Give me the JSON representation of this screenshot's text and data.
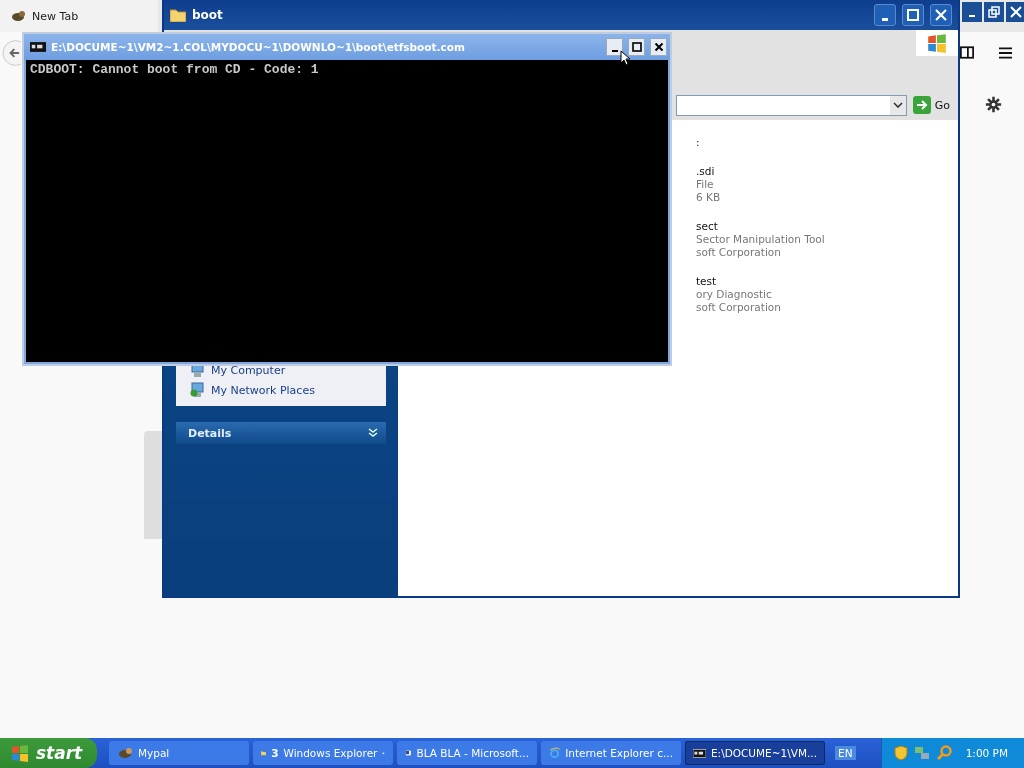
{
  "browser": {
    "tab": "New Tab"
  },
  "explorer": {
    "title": "boot",
    "go": "Go",
    "places": [
      "My Computer",
      "My Network Places"
    ],
    "details_title": "Details",
    "files": [
      {
        "name": ":"
      },
      {
        "name": ".sdi",
        "lines": [
          "File",
          "6 KB"
        ]
      },
      {
        "name": "sect",
        "lines": [
          "Sector Manipulation Tool",
          "soft Corporation"
        ]
      },
      {
        "name": "test",
        "lines": [
          "ory Diagnostic",
          "soft Corporation"
        ]
      }
    ]
  },
  "console": {
    "title": "E:\\DOCUME~1\\VM2~1.COL\\MYDOCU~1\\DOWNLO~1\\boot\\etfsboot.com",
    "output": "CDBOOT: Cannot boot from CD - Code: 1"
  },
  "taskbar": {
    "start": "start",
    "items": [
      {
        "kind": "browser",
        "label": "Mypal",
        "selected": false
      },
      {
        "kind": "folder",
        "count": "3",
        "label": "Windows Explorer",
        "selected": false
      },
      {
        "kind": "word",
        "label": "BLA BLA - Microsoft...",
        "selected": false
      },
      {
        "kind": "ie",
        "label": "Internet Explorer c...",
        "selected": false
      },
      {
        "kind": "console",
        "label": "E:\\DOCUME~1\\VM...",
        "selected": true
      }
    ],
    "language": "EN",
    "clock": "1:00 PM"
  }
}
